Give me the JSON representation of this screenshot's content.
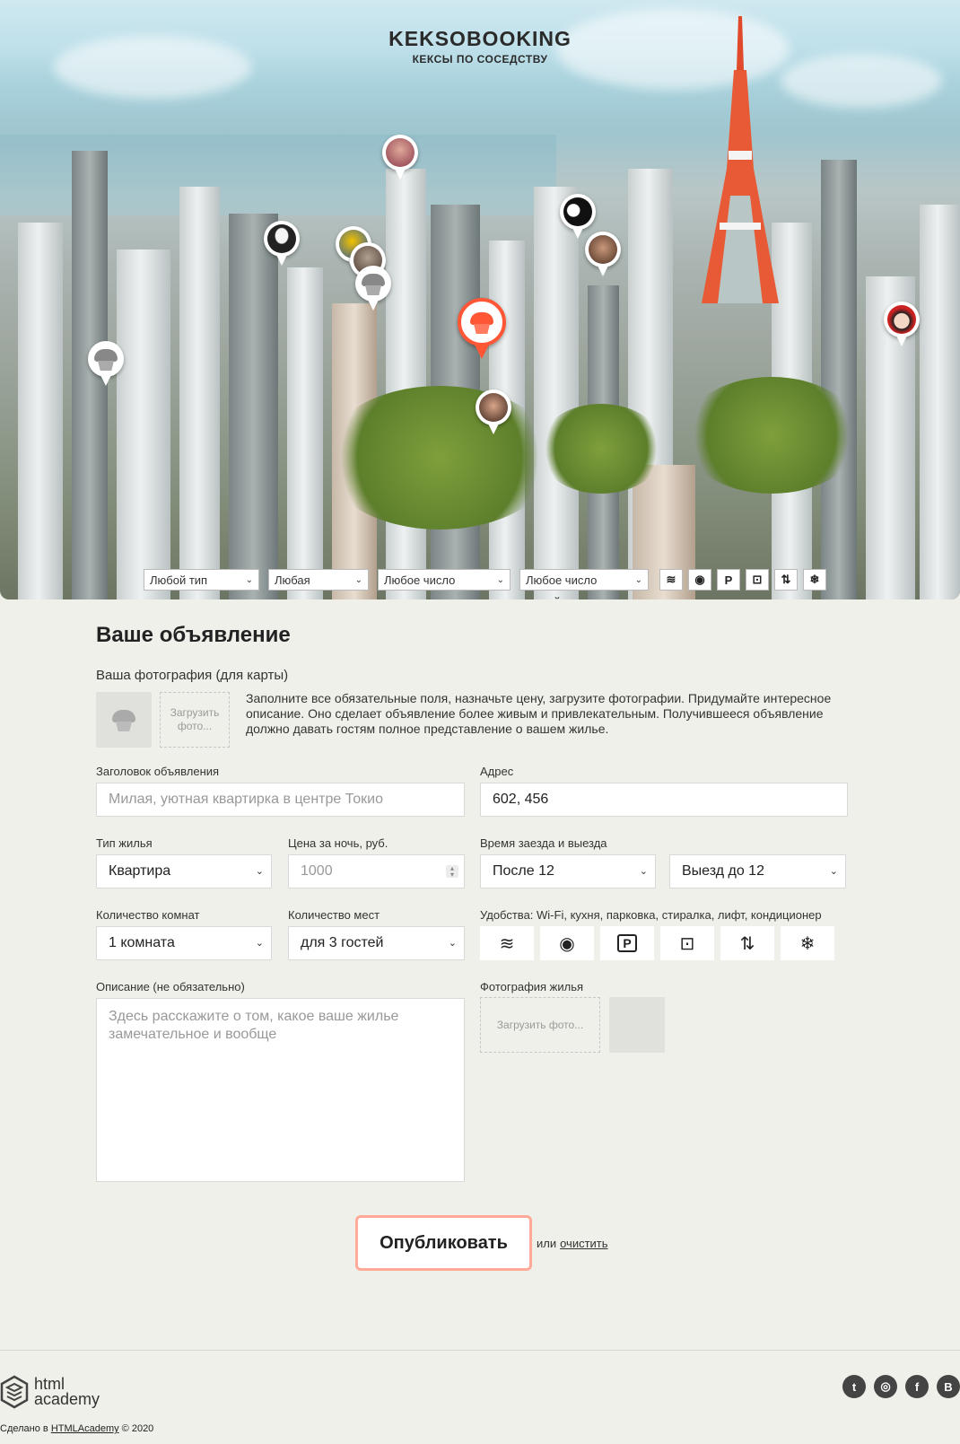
{
  "header": {
    "title": "KEKSOBOOKING",
    "subtitle": "КЕКСЫ ПО СОСЕДСТВУ"
  },
  "map": {
    "pins": [
      {
        "name": "pin-avatar-1",
        "face": "#c98b7a"
      },
      {
        "name": "pin-avatar-2",
        "face": "#333333"
      },
      {
        "name": "pin-avatar-3",
        "face": "#f2c200"
      },
      {
        "name": "pin-avatar-4",
        "face": "#7d6a5b"
      },
      {
        "name": "pin-avatar-5",
        "face": "#222222"
      },
      {
        "name": "pin-avatar-6",
        "face": "#8a6048"
      },
      {
        "name": "pin-avatar-7",
        "face": "#cc2222"
      },
      {
        "name": "pin-avatar-8",
        "face": "#5a3a2a"
      }
    ],
    "main_pin_color": "#ff5635"
  },
  "filters": {
    "housing_type": "Любой тип жилья",
    "price": "Любая",
    "rooms": "Любое число комнат",
    "guests": "Любое число гостей",
    "features": [
      "wifi-icon",
      "dishwasher-icon",
      "parking-icon",
      "washer-icon",
      "elevator-icon",
      "conditioner-icon"
    ]
  },
  "form": {
    "title": "Ваше объявление",
    "avatar_label": "Ваша фотография (для карты)",
    "avatar_upload": "Загрузить фото...",
    "hint": "Заполните все обязательные поля, назначьте цену, загрузите фотографии. Придумайте интересное описание. Оно сделает объявление более живым и привлекательным. Получившееся объявление должно давать гостям полное представление о вашем жилье.",
    "title_label": "Заголовок объявления",
    "title_placeholder": "Милая, уютная квартирка в центре Токио",
    "address_label": "Адрес",
    "address_value": "602, 456",
    "type_label": "Тип жилья",
    "type_value": "Квартира",
    "price_label": "Цена за ночь, руб.",
    "price_placeholder": "1000",
    "time_label": "Время заезда и выезда",
    "timein_value": "После 12",
    "timeout_value": "Выезд до 12",
    "rooms_label": "Количество комнат",
    "rooms_value": "1 комната",
    "capacity_label": "Количество мест",
    "capacity_value": "для 3 гостей",
    "features_label": "Удобства: Wi-Fi, кухня, парковка, стиралка, лифт, кондиционер",
    "description_label": "Описание (не обязательно)",
    "description_placeholder": "Здесь расскажите о том, какое ваше жилье замечательное и вообще",
    "photo_label": "Фотография жилья",
    "photo_upload": "Загрузить фото...",
    "submit": "Опубликовать",
    "or": "или",
    "reset": "очистить"
  },
  "footer": {
    "logo_line1": "html",
    "logo_line2": "academy",
    "copyright_prefix": "Сделано в",
    "copyright_link": "HTMLAcademy",
    "copyright_suffix": "© 2020",
    "socials": [
      "twitter-icon",
      "instagram-icon",
      "facebook-icon",
      "vk-icon"
    ]
  },
  "colors": {
    "accent": "#ff5635",
    "button_border": "#ffaa99",
    "background": "#f0f0ea"
  }
}
